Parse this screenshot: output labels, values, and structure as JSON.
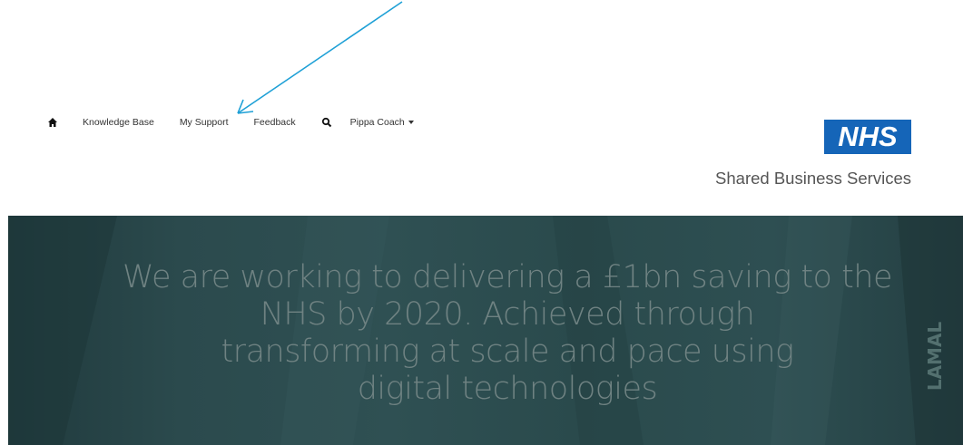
{
  "nav": {
    "home_icon": "home-icon",
    "items": [
      {
        "label": "Knowledge Base"
      },
      {
        "label": "My Support"
      },
      {
        "label": "Feedback"
      }
    ],
    "search_icon": "search-icon",
    "user_menu": {
      "label": "Pippa Coach"
    }
  },
  "brand": {
    "logo_text": "NHS",
    "subtitle": "Shared Business Services",
    "logo_color": "#1565b8"
  },
  "hero": {
    "lines": [
      "We are working to delivering a £1bn saving to the",
      "NHS by 2020.  Achieved through",
      "transforming at scale and pace using",
      "digital technologies"
    ],
    "side_text": "LAMAL"
  },
  "annotation": {
    "arrow_color": "#1ea0d6"
  }
}
